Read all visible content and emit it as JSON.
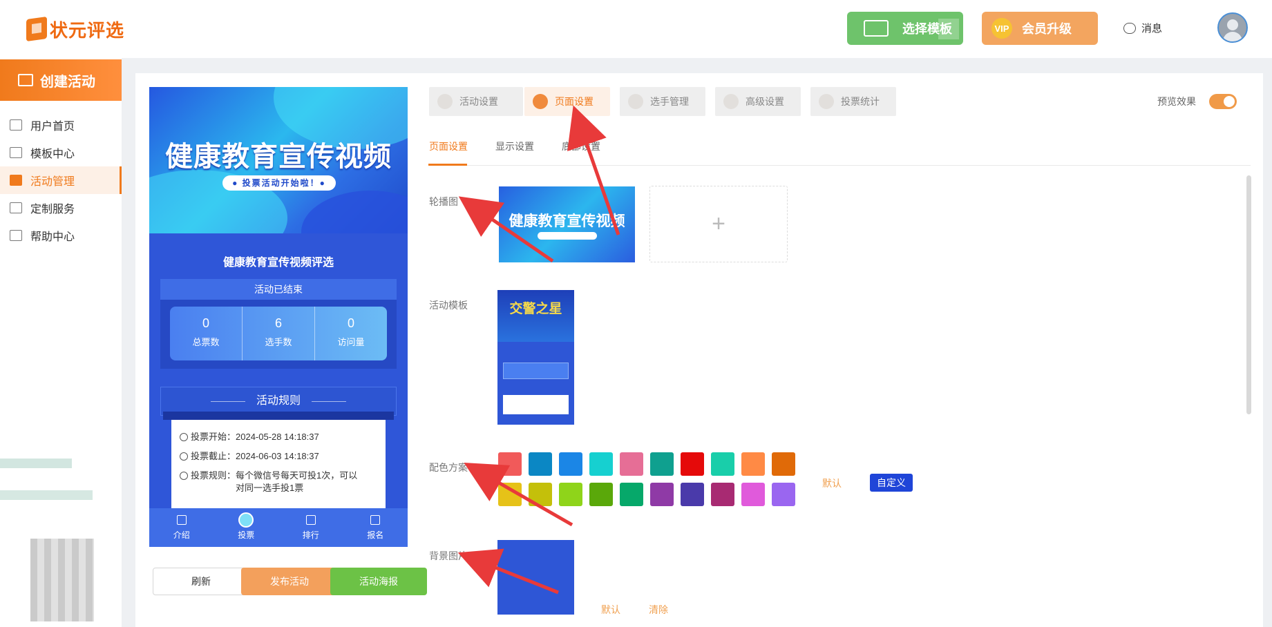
{
  "header": {
    "logo_text": "状元评选",
    "choose_template": "选择模板",
    "vip_badge": "VIP",
    "vip_upgrade": "会员升级",
    "messages": "消息"
  },
  "sidebar": {
    "create": "创建活动",
    "items": [
      {
        "label": "用户首页",
        "icon": "home-icon"
      },
      {
        "label": "模板中心",
        "icon": "folder-icon"
      },
      {
        "label": "活动管理",
        "icon": "ticket-icon"
      },
      {
        "label": "定制服务",
        "icon": "tools-icon"
      },
      {
        "label": "帮助中心",
        "icon": "book-icon"
      }
    ]
  },
  "preview": {
    "banner_title": "健康教育宣传视频",
    "banner_pill": "● 投票活动开始啦！●",
    "activity_name": "健康教育宣传视频评选",
    "status": "活动已结束",
    "stats": [
      {
        "value": "0",
        "label": "总票数"
      },
      {
        "value": "6",
        "label": "选手数"
      },
      {
        "value": "0",
        "label": "访问量"
      }
    ],
    "rules_title": "活动规则",
    "rules": [
      {
        "label": "投票开始：",
        "value": "2024-05-28 14:18:37"
      },
      {
        "label": "投票截止：",
        "value": "2024-06-03 14:18:37"
      },
      {
        "label": "投票规则：",
        "value": "每个微信号每天可投1次，可以对同一选手投1票"
      }
    ],
    "tabs": [
      "介绍",
      "投票",
      "排行",
      "报名"
    ]
  },
  "actions": {
    "refresh": "刷新",
    "publish": "发布活动",
    "poster": "活动海报"
  },
  "top_tabs": [
    "活动设置",
    "页面设置",
    "选手管理",
    "高级设置",
    "投票统计"
  ],
  "active_top_tab": "页面设置",
  "preview_effect": "预览效果",
  "preview_enabled": true,
  "sub_tabs": [
    "页面设置",
    "显示设置",
    "底部设置"
  ],
  "fields": {
    "carousel": "轮播图",
    "carousel_image_text": "健康教育宣传视频",
    "add": "+",
    "template": "活动模板",
    "template_image_text": "交警之星",
    "color_scheme": "配色方案",
    "background": "背景图片"
  },
  "colors": [
    "#f15a5a",
    "#0b87c4",
    "#1b86e6",
    "#16d0d0",
    "#e66e96",
    "#0fa08f",
    "#e50a0a",
    "#19ceaa",
    "#ff8a45",
    "#e06a08",
    "#e6c218",
    "#c4c00a",
    "#8fd41a",
    "#5aa80a",
    "#06a86a",
    "#8f3aa6",
    "#4a3aaa",
    "#a82a72",
    "#e05adb",
    "#9a66f0"
  ],
  "color_default": "默认",
  "color_custom": "自定义",
  "bg_default": "默认",
  "bg_clear": "清除"
}
